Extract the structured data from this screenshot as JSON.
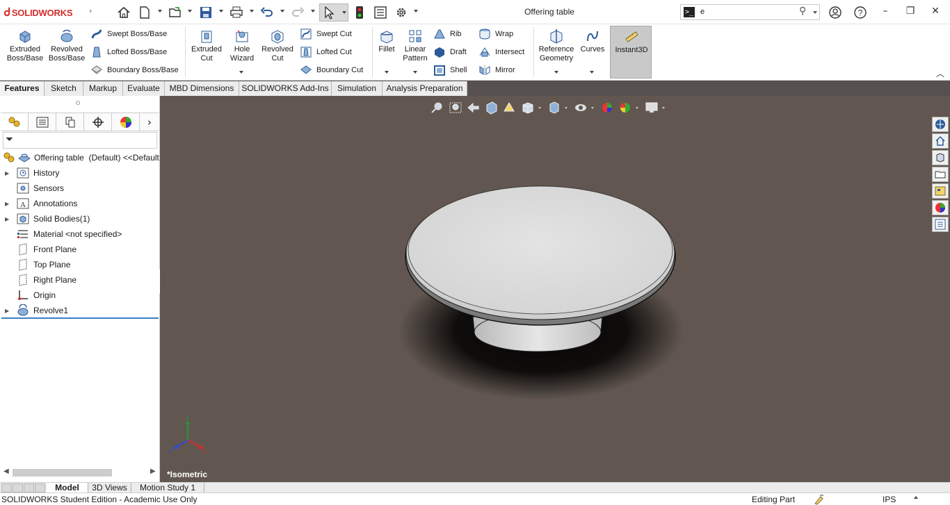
{
  "app": {
    "brand": "SOLIDWORKS",
    "title": "Offering table",
    "search": {
      "prompt": ">_",
      "value": "e"
    }
  },
  "quick_access": {
    "icons": [
      "home-icon",
      "new-document-icon",
      "open-icon",
      "save-icon",
      "print-icon",
      "undo-icon",
      "redo-icon",
      "select-icon",
      "rebuild-icon",
      "file-properties-icon",
      "options-icon"
    ]
  },
  "window_controls": {
    "minimize": "–",
    "restore": "❐",
    "close": "✕"
  },
  "ribbon": {
    "extruded_boss": "Extruded\nBoss/Base",
    "revolved_boss": "Revolved\nBoss/Base",
    "swept_boss": "Swept Boss/Base",
    "lofted_boss": "Lofted Boss/Base",
    "boundary_boss": "Boundary Boss/Base",
    "extruded_cut": "Extruded\nCut",
    "hole_wizard": "Hole\nWizard",
    "revolved_cut": "Revolved\nCut",
    "swept_cut": "Swept Cut",
    "lofted_cut": "Lofted Cut",
    "boundary_cut": "Boundary Cut",
    "fillet": "Fillet",
    "linear_pattern": "Linear\nPattern",
    "rib": "Rib",
    "draft": "Draft",
    "shell": "Shell",
    "wrap": "Wrap",
    "intersect": "Intersect",
    "mirror": "Mirror",
    "reference_geometry": "Reference\nGeometry",
    "curves": "Curves",
    "instant3d": "Instant3D"
  },
  "command_tabs": [
    "Features",
    "Sketch",
    "Markup",
    "Evaluate",
    "MBD Dimensions",
    "SOLIDWORKS Add-Ins",
    "Simulation",
    "Analysis Preparation"
  ],
  "feature_tree": {
    "root": "Offering table  (Default) <<Default",
    "items": [
      {
        "label": "History",
        "expandable": true
      },
      {
        "label": "Sensors",
        "expandable": false
      },
      {
        "label": "Annotations",
        "expandable": true
      },
      {
        "label": "Solid Bodies(1)",
        "expandable": true
      },
      {
        "label": "Material <not specified>",
        "expandable": false
      },
      {
        "label": "Front Plane",
        "expandable": false
      },
      {
        "label": "Top Plane",
        "expandable": false
      },
      {
        "label": "Right Plane",
        "expandable": false
      },
      {
        "label": "Origin",
        "expandable": false
      },
      {
        "label": "Revolve1",
        "expandable": true
      }
    ]
  },
  "viewport": {
    "view_label": "*Isometric",
    "triad": {
      "x": "X",
      "y": "Y",
      "z": "Z"
    },
    "background_color": "#625750"
  },
  "bottom_tabs": [
    "Model",
    "3D Views",
    "Motion Study 1"
  ],
  "status": {
    "edition": "SOLIDWORKS Student Edition - Academic Use Only",
    "mode": "Editing Part",
    "units": "IPS"
  },
  "colors": {
    "brand_red": "#d42c2c",
    "selection_blue": "#3b7fc4"
  }
}
